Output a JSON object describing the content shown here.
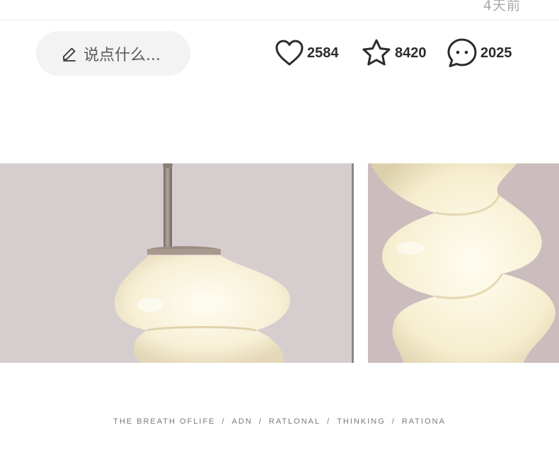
{
  "header": {
    "time_ago": "4天前"
  },
  "comment_box": {
    "placeholder": "说点什么..."
  },
  "stats": {
    "likes": "2584",
    "favorites": "8420",
    "comments": "2025"
  },
  "icons": {
    "pen": "pencil-icon",
    "like": "heart-outline-icon",
    "favorite": "star-outline-icon",
    "comment": "speech-bubble-icon"
  },
  "colors": {
    "pill_bg": "#f3f3f3",
    "text_dark": "#2b2b2b",
    "panel_left_bg": "#d6cdcf",
    "panel_right_bg": "#cbbdbd",
    "lamp_glass": "#fbf7e6"
  },
  "tagline": {
    "parts": [
      "THE BREATH OFLIFE",
      "ADN",
      "RATLONAL",
      "THINKING",
      "RATIONA"
    ],
    "separator": "/"
  }
}
